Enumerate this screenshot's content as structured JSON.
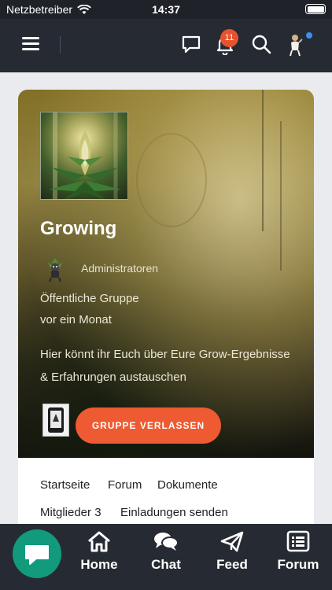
{
  "status_bar": {
    "carrier": "Netzbetreiber",
    "time": "14:37"
  },
  "header": {
    "notification_count": "11"
  },
  "group": {
    "title": "Growing",
    "role": "Administratoren",
    "privacy": "Öffentliche Gruppe",
    "created": "vor ein Monat",
    "description": "Hier könnt ihr Euch über Eure Grow-Ergebnisse & Erfahrungen austauschen",
    "leave_label": "GRUPPE VERLASSEN"
  },
  "tabs": [
    {
      "label": "Startseite"
    },
    {
      "label": "Forum"
    },
    {
      "label": "Dokumente"
    },
    {
      "label": "Mitglieder 3"
    },
    {
      "label": "Einladungen senden"
    }
  ],
  "bottom_nav": [
    {
      "label": "Home",
      "icon": "home-icon"
    },
    {
      "label": "Chat",
      "icon": "chat-bubbles-icon"
    },
    {
      "label": "Feed",
      "icon": "paper-plane-icon"
    },
    {
      "label": "Forum",
      "icon": "list-icon"
    }
  ],
  "colors": {
    "accent": "#ee5a31",
    "fab": "#129a7c",
    "header_bg": "#262b33",
    "badge": "#e8532f"
  }
}
